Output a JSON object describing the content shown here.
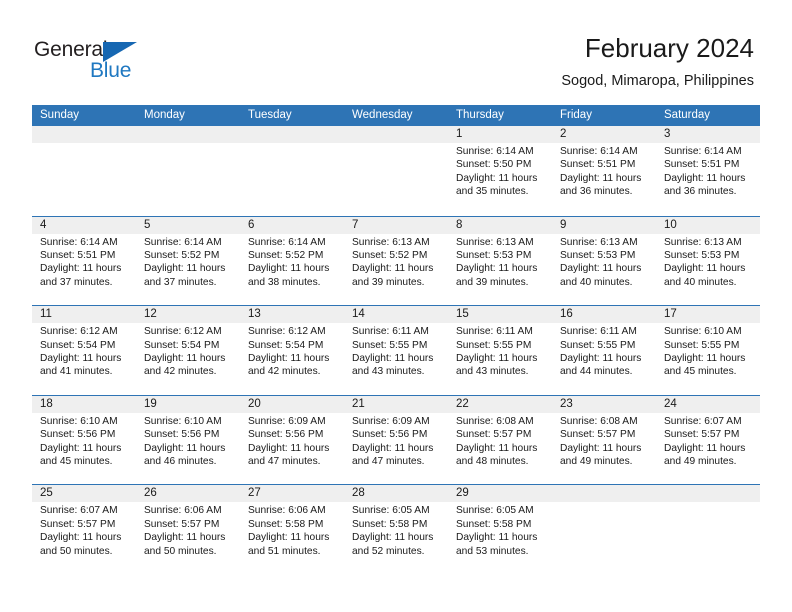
{
  "logo": {
    "word_one": "General",
    "word_two": "Blue",
    "triangle_icon": "blue-triangle-icon",
    "triangle_color": "#1667b2",
    "blue_text_color": "#1f78c1"
  },
  "header": {
    "title": "February 2024",
    "subtitle": "Sogod, Mimaropa, Philippines"
  },
  "theme": {
    "header_bar": "#2e74b5",
    "daynum_band": "#efefef",
    "text": "#1a1a1a"
  },
  "calendar": {
    "weekdays": [
      "Sunday",
      "Monday",
      "Tuesday",
      "Wednesday",
      "Thursday",
      "Friday",
      "Saturday"
    ],
    "weeks": [
      [
        {
          "day": "",
          "lines": []
        },
        {
          "day": "",
          "lines": []
        },
        {
          "day": "",
          "lines": []
        },
        {
          "day": "",
          "lines": []
        },
        {
          "day": "1",
          "lines": [
            "Sunrise: 6:14 AM",
            "Sunset: 5:50 PM",
            "Daylight: 11 hours",
            "and 35 minutes."
          ]
        },
        {
          "day": "2",
          "lines": [
            "Sunrise: 6:14 AM",
            "Sunset: 5:51 PM",
            "Daylight: 11 hours",
            "and 36 minutes."
          ]
        },
        {
          "day": "3",
          "lines": [
            "Sunrise: 6:14 AM",
            "Sunset: 5:51 PM",
            "Daylight: 11 hours",
            "and 36 minutes."
          ]
        }
      ],
      [
        {
          "day": "4",
          "lines": [
            "Sunrise: 6:14 AM",
            "Sunset: 5:51 PM",
            "Daylight: 11 hours",
            "and 37 minutes."
          ]
        },
        {
          "day": "5",
          "lines": [
            "Sunrise: 6:14 AM",
            "Sunset: 5:52 PM",
            "Daylight: 11 hours",
            "and 37 minutes."
          ]
        },
        {
          "day": "6",
          "lines": [
            "Sunrise: 6:14 AM",
            "Sunset: 5:52 PM",
            "Daylight: 11 hours",
            "and 38 minutes."
          ]
        },
        {
          "day": "7",
          "lines": [
            "Sunrise: 6:13 AM",
            "Sunset: 5:52 PM",
            "Daylight: 11 hours",
            "and 39 minutes."
          ]
        },
        {
          "day": "8",
          "lines": [
            "Sunrise: 6:13 AM",
            "Sunset: 5:53 PM",
            "Daylight: 11 hours",
            "and 39 minutes."
          ]
        },
        {
          "day": "9",
          "lines": [
            "Sunrise: 6:13 AM",
            "Sunset: 5:53 PM",
            "Daylight: 11 hours",
            "and 40 minutes."
          ]
        },
        {
          "day": "10",
          "lines": [
            "Sunrise: 6:13 AM",
            "Sunset: 5:53 PM",
            "Daylight: 11 hours",
            "and 40 minutes."
          ]
        }
      ],
      [
        {
          "day": "11",
          "lines": [
            "Sunrise: 6:12 AM",
            "Sunset: 5:54 PM",
            "Daylight: 11 hours",
            "and 41 minutes."
          ]
        },
        {
          "day": "12",
          "lines": [
            "Sunrise: 6:12 AM",
            "Sunset: 5:54 PM",
            "Daylight: 11 hours",
            "and 42 minutes."
          ]
        },
        {
          "day": "13",
          "lines": [
            "Sunrise: 6:12 AM",
            "Sunset: 5:54 PM",
            "Daylight: 11 hours",
            "and 42 minutes."
          ]
        },
        {
          "day": "14",
          "lines": [
            "Sunrise: 6:11 AM",
            "Sunset: 5:55 PM",
            "Daylight: 11 hours",
            "and 43 minutes."
          ]
        },
        {
          "day": "15",
          "lines": [
            "Sunrise: 6:11 AM",
            "Sunset: 5:55 PM",
            "Daylight: 11 hours",
            "and 43 minutes."
          ]
        },
        {
          "day": "16",
          "lines": [
            "Sunrise: 6:11 AM",
            "Sunset: 5:55 PM",
            "Daylight: 11 hours",
            "and 44 minutes."
          ]
        },
        {
          "day": "17",
          "lines": [
            "Sunrise: 6:10 AM",
            "Sunset: 5:55 PM",
            "Daylight: 11 hours",
            "and 45 minutes."
          ]
        }
      ],
      [
        {
          "day": "18",
          "lines": [
            "Sunrise: 6:10 AM",
            "Sunset: 5:56 PM",
            "Daylight: 11 hours",
            "and 45 minutes."
          ]
        },
        {
          "day": "19",
          "lines": [
            "Sunrise: 6:10 AM",
            "Sunset: 5:56 PM",
            "Daylight: 11 hours",
            "and 46 minutes."
          ]
        },
        {
          "day": "20",
          "lines": [
            "Sunrise: 6:09 AM",
            "Sunset: 5:56 PM",
            "Daylight: 11 hours",
            "and 47 minutes."
          ]
        },
        {
          "day": "21",
          "lines": [
            "Sunrise: 6:09 AM",
            "Sunset: 5:56 PM",
            "Daylight: 11 hours",
            "and 47 minutes."
          ]
        },
        {
          "day": "22",
          "lines": [
            "Sunrise: 6:08 AM",
            "Sunset: 5:57 PM",
            "Daylight: 11 hours",
            "and 48 minutes."
          ]
        },
        {
          "day": "23",
          "lines": [
            "Sunrise: 6:08 AM",
            "Sunset: 5:57 PM",
            "Daylight: 11 hours",
            "and 49 minutes."
          ]
        },
        {
          "day": "24",
          "lines": [
            "Sunrise: 6:07 AM",
            "Sunset: 5:57 PM",
            "Daylight: 11 hours",
            "and 49 minutes."
          ]
        }
      ],
      [
        {
          "day": "25",
          "lines": [
            "Sunrise: 6:07 AM",
            "Sunset: 5:57 PM",
            "Daylight: 11 hours",
            "and 50 minutes."
          ]
        },
        {
          "day": "26",
          "lines": [
            "Sunrise: 6:06 AM",
            "Sunset: 5:57 PM",
            "Daylight: 11 hours",
            "and 50 minutes."
          ]
        },
        {
          "day": "27",
          "lines": [
            "Sunrise: 6:06 AM",
            "Sunset: 5:58 PM",
            "Daylight: 11 hours",
            "and 51 minutes."
          ]
        },
        {
          "day": "28",
          "lines": [
            "Sunrise: 6:05 AM",
            "Sunset: 5:58 PM",
            "Daylight: 11 hours",
            "and 52 minutes."
          ]
        },
        {
          "day": "29",
          "lines": [
            "Sunrise: 6:05 AM",
            "Sunset: 5:58 PM",
            "Daylight: 11 hours",
            "and 53 minutes."
          ]
        },
        {
          "day": "",
          "lines": []
        },
        {
          "day": "",
          "lines": []
        }
      ]
    ]
  }
}
